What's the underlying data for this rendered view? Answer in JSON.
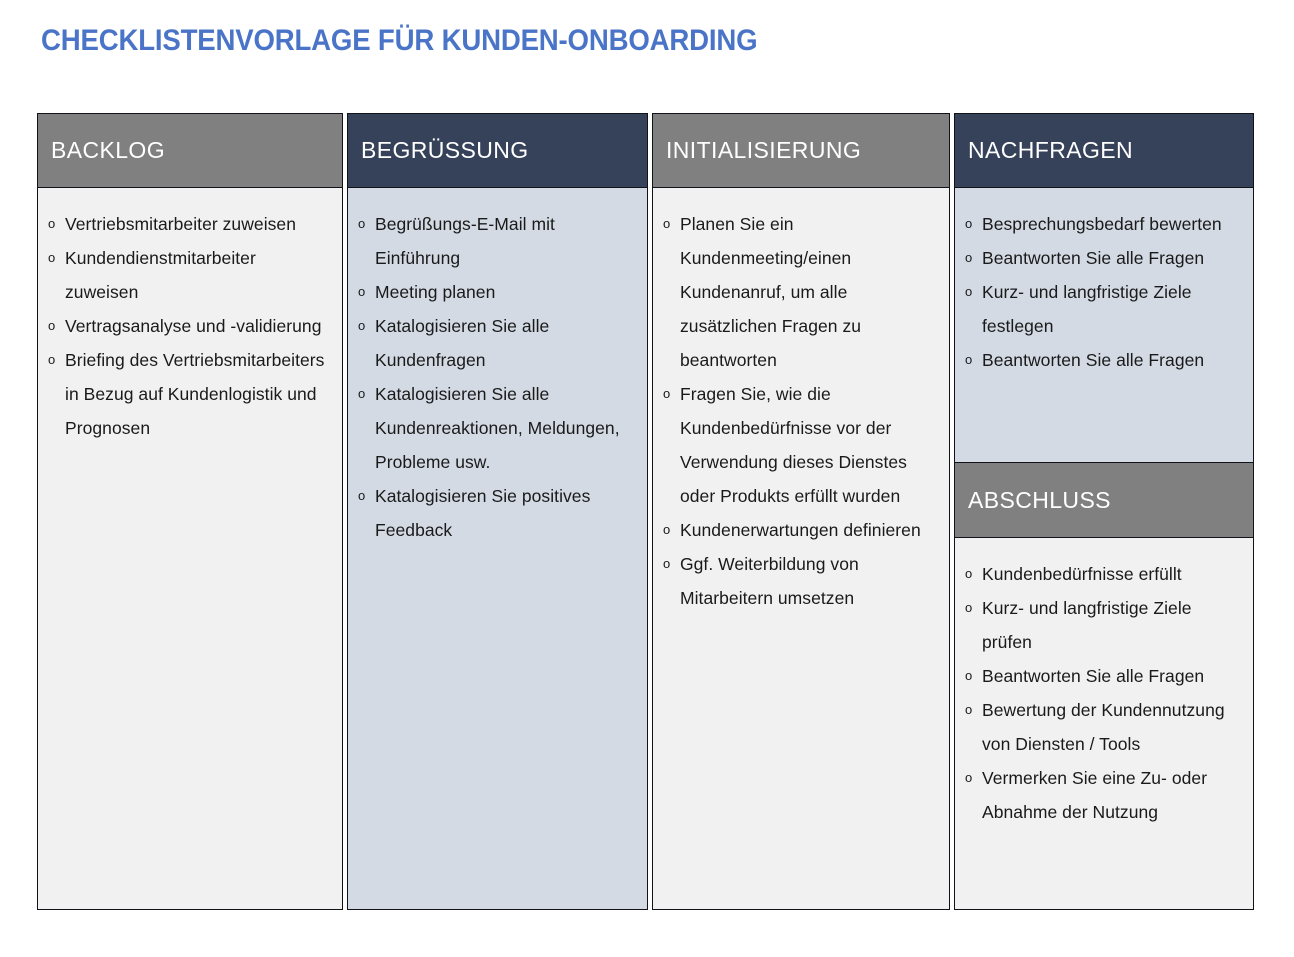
{
  "document": {
    "title": "CHECKLISTENVORLAGE FÜR KUNDEN-ONBOARDING"
  },
  "colors": {
    "title_blue": "#4a74c8",
    "header_gray": "#808080",
    "header_navy": "#36425a",
    "body_light": "#f1f1f1",
    "body_blue": "#d3dae4",
    "border": "#111318",
    "text": "#1a1a1a"
  },
  "bullet": {
    "glyph": "o",
    "icon_name": "hollow-circle-checkbox-icon"
  },
  "columns": [
    {
      "id": "backlog",
      "header": "BACKLOG",
      "header_style": "gray",
      "body_style": "light",
      "items": [
        "Vertriebsmitarbeiter zuweisen",
        "Kundendienstmitarbeiter zuweisen",
        "Vertragsanalyse und -validierung",
        "Briefing des Vertriebsmitarbeiters in Bezug auf Kundenlogistik und Prognosen"
      ]
    },
    {
      "id": "begruessung",
      "header": "BEGRÜSSUNG",
      "header_style": "navy",
      "body_style": "blue",
      "items": [
        "Begrüßungs-E-Mail mit Einführung",
        "Meeting planen",
        "Katalogisieren Sie alle Kundenfragen",
        "Katalogisieren Sie alle Kundenreaktionen, Meldungen, Probleme usw.",
        "Katalogisieren Sie positives Feedback"
      ]
    },
    {
      "id": "initialisierung",
      "header": "INITIALISIERUNG",
      "header_style": "gray",
      "body_style": "light",
      "items": [
        "Planen Sie ein Kundenmeeting/einen Kundenanruf, um alle zusätzlichen Fragen zu beantworten",
        "Fragen Sie, wie die Kundenbedürfnisse vor der Verwendung dieses Dienstes oder Produkts erfüllt wurden",
        "Kundenerwartungen definieren",
        "Ggf. Weiterbildung von Mitarbeitern umsetzen"
      ]
    },
    {
      "id": "nachfragen",
      "header": "NACHFRAGEN",
      "header_style": "navy",
      "body_style": "blue",
      "items": [
        "Besprechungsbedarf bewerten",
        "Beantworten Sie alle Fragen",
        "Kurz- und langfristige Ziele festlegen",
        "Beantworten Sie alle Fragen"
      ],
      "subsection": {
        "id": "abschluss",
        "header": "ABSCHLUSS",
        "header_style": "gray",
        "body_style": "light",
        "items": [
          "Kundenbedürfnisse erfüllt",
          "Kurz- und langfristige Ziele prüfen",
          "Beantworten Sie alle Fragen",
          "Bewertung der Kundennutzung von Diensten / Tools",
          "Vermerken Sie eine Zu- oder Abnahme der Nutzung"
        ]
      }
    }
  ]
}
